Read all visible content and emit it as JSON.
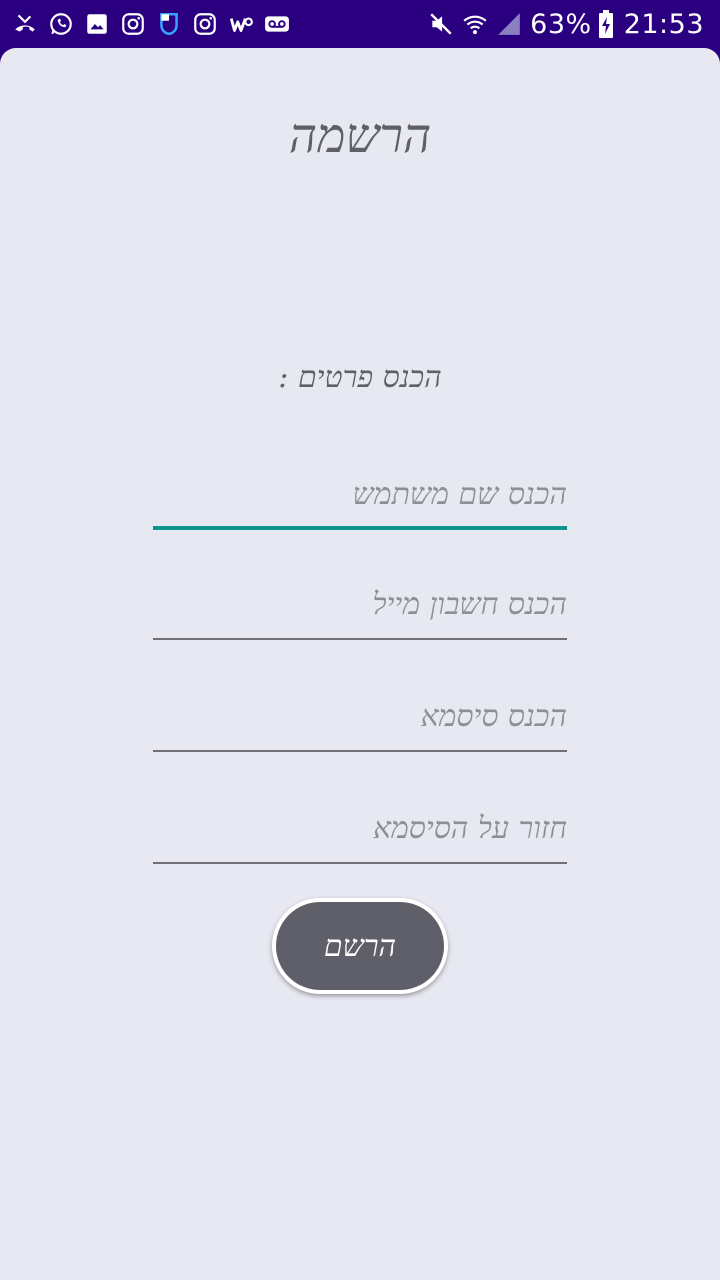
{
  "status_bar": {
    "left_icons": [
      "missed-call-icon",
      "whatsapp-icon",
      "gallery-icon",
      "instagram-icon",
      "shield-app-icon",
      "instagram-icon",
      "w-app-icon",
      "voicemail-icon"
    ],
    "right_icons": [
      "mute-icon",
      "wifi-icon",
      "signal-icon"
    ],
    "battery": "63%",
    "time": "21:53",
    "background_color": "#2a0080"
  },
  "page": {
    "title": "הרשמה",
    "details_label": "הכנס פרטים :"
  },
  "form": {
    "username_placeholder": "הכנס שם משתמש",
    "email_placeholder": "הכנס חשבון מייל",
    "password_placeholder": "הכנס סיסמא",
    "confirm_password_placeholder": "חזור על הסיסמא",
    "username_value": "",
    "email_value": "",
    "password_value": "",
    "confirm_password_value": ""
  },
  "register_button": {
    "label": "הרשם",
    "color": "#5f5f69"
  },
  "colors": {
    "card_background": "#e8e8f2",
    "focus_accent": "#11948a",
    "text": "#5f5f66"
  }
}
